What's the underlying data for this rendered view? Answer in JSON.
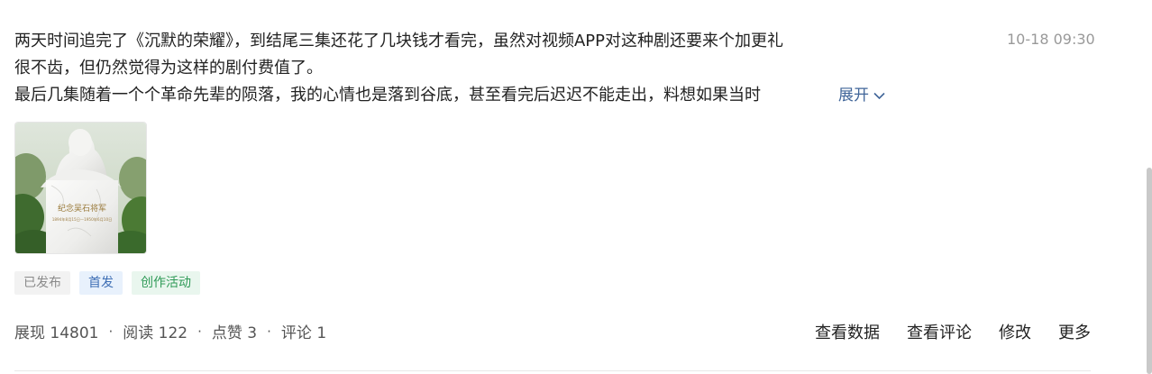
{
  "post": {
    "lines": [
      "两天时间追完了《沉默的荣耀》，到结尾三集还花了几块钱才看完，虽然对视频APP对这种剧还要来个加更礼",
      "很不齿，但仍然觉得为这样的剧付费值了。",
      "最后几集随着一个个革命先辈的陨落，我的心情也是落到谷底，甚至看完后迟迟不能走出，料想如果当时"
    ],
    "expand_label": "展开",
    "timestamp": "10-18 09:30",
    "image": {
      "plaque_text": "纪念吴石将军",
      "plaque_dates": "1894年8月15日—1950年6月10日"
    }
  },
  "tags": [
    "已发布",
    "首发",
    "创作活动"
  ],
  "stats": {
    "impressions": "展现 14801",
    "reads": "阅读 122",
    "likes": "点赞 3",
    "comments": "评论 1",
    "separator": "·"
  },
  "actions": [
    "查看数据",
    "查看评论",
    "修改",
    "更多"
  ],
  "colors": {
    "expand_link": "#406599",
    "tag_blue_text": "#3f6fb5",
    "tag_green_text": "#2f9a57",
    "timestamp": "#999999"
  },
  "icons": {
    "expand": "chevron-down-icon"
  }
}
